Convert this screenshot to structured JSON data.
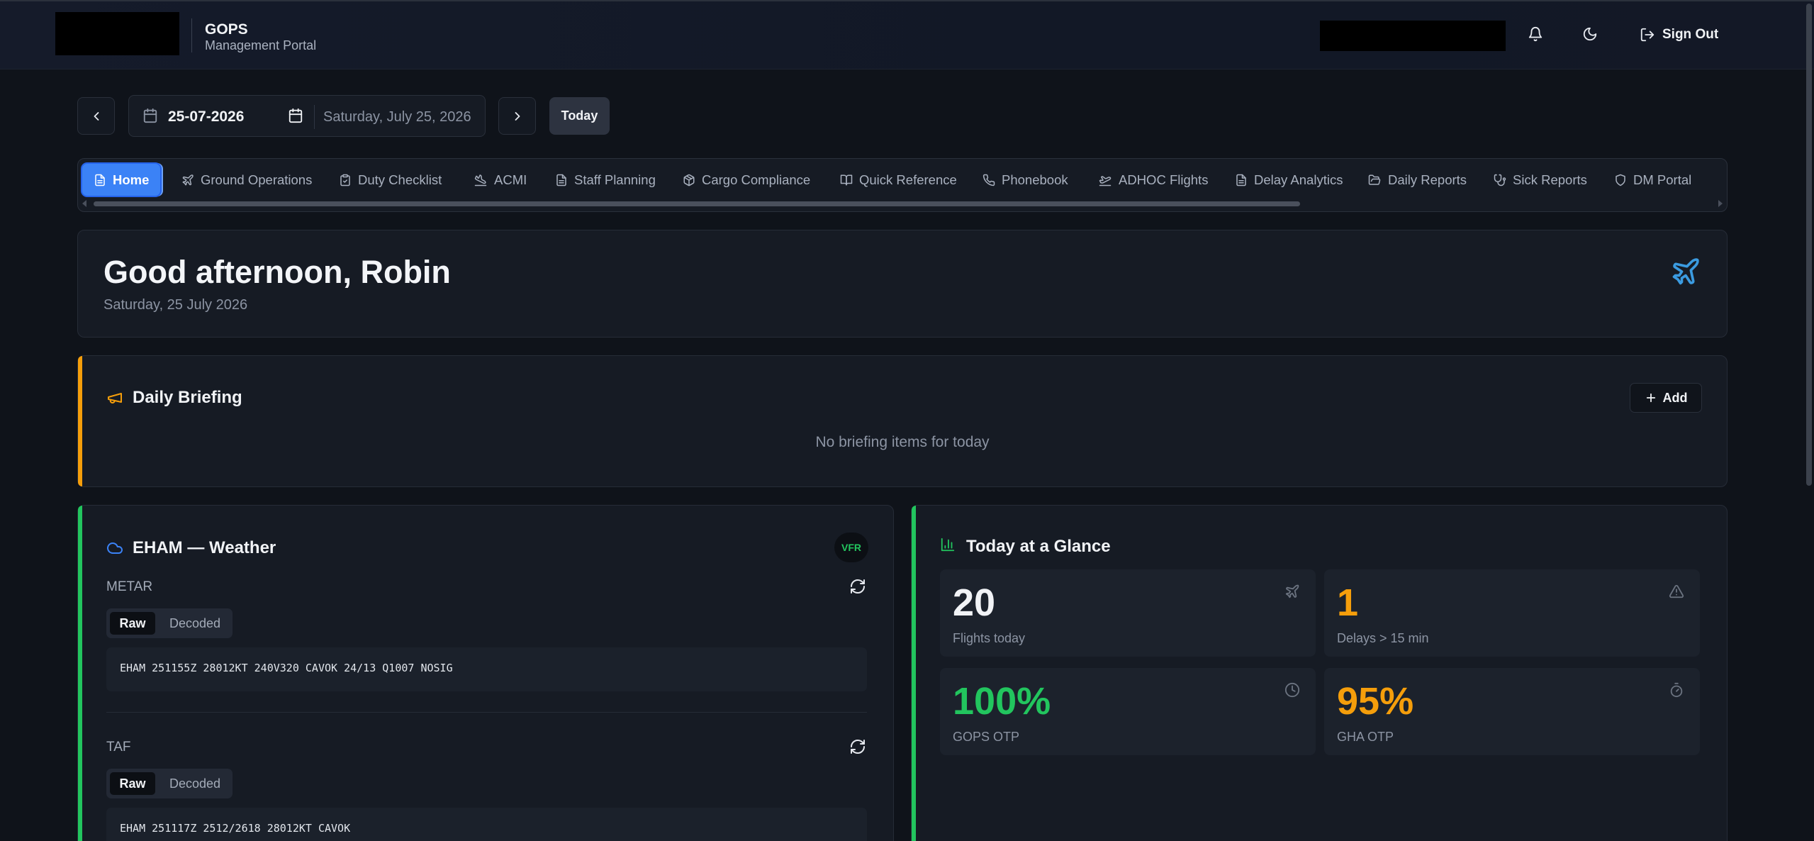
{
  "header": {
    "brand_title": "GOPS",
    "brand_subtitle": "Management Portal",
    "sign_out": "Sign Out"
  },
  "date_nav": {
    "date_value": "25-07-2026",
    "date_long": "Saturday, July 25, 2026",
    "today_label": "Today"
  },
  "tabs": [
    {
      "label": "Home",
      "icon": "file-icon",
      "active": true
    },
    {
      "label": "Ground Operations",
      "icon": "plane-departure-icon"
    },
    {
      "label": "Duty Checklist",
      "icon": "clipboard-check-icon"
    },
    {
      "label": "ACMI",
      "icon": "plane-landing-icon"
    },
    {
      "label": "Staff Planning",
      "icon": "file-text-icon"
    },
    {
      "label": "Cargo Compliance",
      "icon": "package-icon"
    },
    {
      "label": "Quick Reference",
      "icon": "book-open-icon"
    },
    {
      "label": "Phonebook",
      "icon": "phone-icon"
    },
    {
      "label": "ADHOC Flights",
      "icon": "plane-takeoff-icon"
    },
    {
      "label": "Delay Analytics",
      "icon": "file-text-icon"
    },
    {
      "label": "Daily Reports",
      "icon": "folder-open-icon"
    },
    {
      "label": "Sick Reports",
      "icon": "stethoscope-icon"
    },
    {
      "label": "DM Portal",
      "icon": "shield-icon"
    }
  ],
  "greeting": {
    "title": "Good afternoon, Robin",
    "date": "Saturday, 25 July 2026"
  },
  "briefing": {
    "title": "Daily Briefing",
    "add_label": "Add",
    "empty_text": "No briefing items for today"
  },
  "weather": {
    "title": "EHAM — Weather",
    "badge": "VFR",
    "metar": {
      "label": "METAR",
      "raw_tab": "Raw",
      "decoded_tab": "Decoded",
      "text": "EHAM 251155Z 28012KT 240V320 CAVOK 24/13 Q1007 NOSIG"
    },
    "taf": {
      "label": "TAF",
      "raw_tab": "Raw",
      "decoded_tab": "Decoded",
      "text": "EHAM 251117Z 2512/2618 28012KT CAVOK"
    }
  },
  "glance": {
    "title": "Today at a Glance",
    "stats": [
      {
        "value": "20",
        "label": "Flights today",
        "color": "#f1f3f6",
        "icon": "plane-icon"
      },
      {
        "value": "1",
        "label": "Delays > 15 min",
        "color": "#f59e0b",
        "icon": "alert-triangle-icon"
      },
      {
        "value": "100%",
        "label": "GOPS OTP",
        "color": "#22c55e",
        "icon": "clock-icon"
      },
      {
        "value": "95%",
        "label": "GHA OTP",
        "color": "#f59e0b",
        "icon": "timer-icon"
      }
    ]
  },
  "colors": {
    "accent_blue": "#3b82f6",
    "briefing_accent": "#f59e0b",
    "weather_accent": "#22c55e"
  }
}
